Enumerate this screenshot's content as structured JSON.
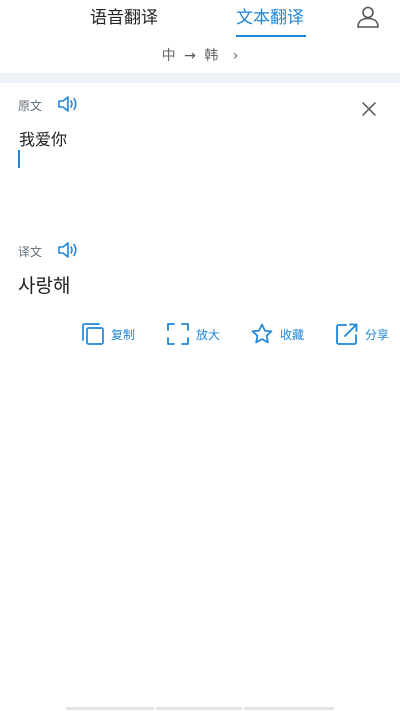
{
  "tabs": {
    "voice": "语音翻译",
    "text": "文本翻译"
  },
  "language": {
    "source": "中",
    "arrow": "→",
    "target": "韩",
    "chevron": "›"
  },
  "source": {
    "label": "原文",
    "text": "我爱你"
  },
  "result": {
    "label": "译文",
    "text": "사랑해"
  },
  "actions": {
    "copy": "复制",
    "zoom": "放大",
    "favorite": "收藏",
    "share": "分享"
  },
  "colors": {
    "accent": "#1f86d8",
    "band": "#eef3f9"
  }
}
